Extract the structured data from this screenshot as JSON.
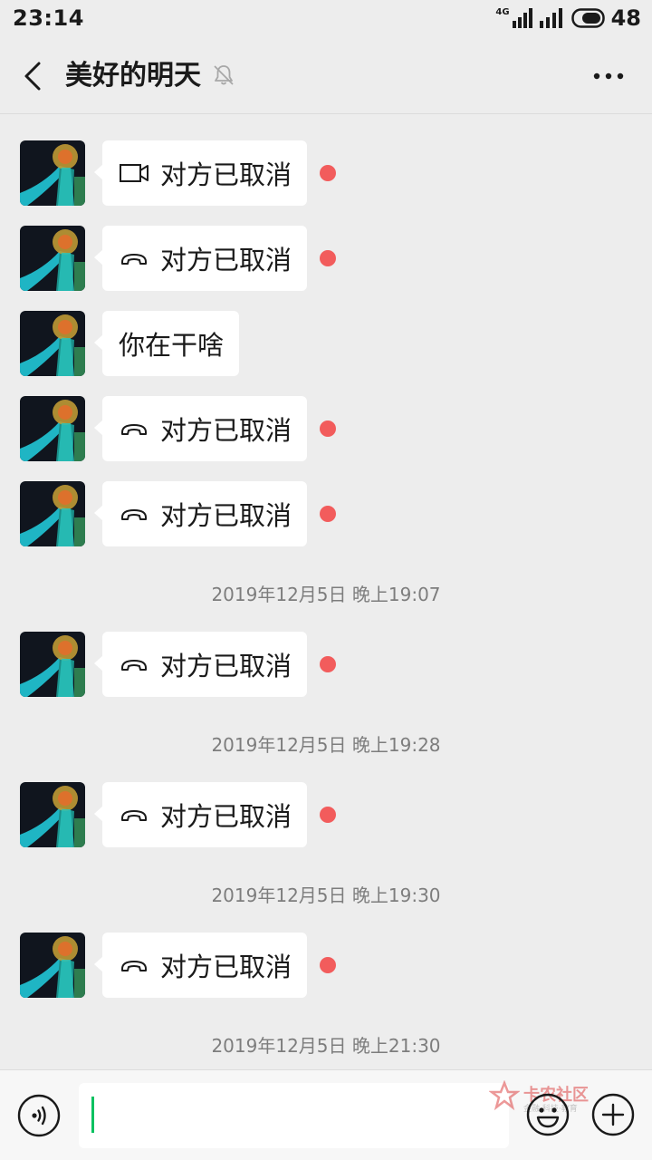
{
  "status_bar": {
    "time": "23:14",
    "network": "4G",
    "battery": "48"
  },
  "header": {
    "title": "美好的明天"
  },
  "colors": {
    "background": "#ededed",
    "bubble": "#ffffff",
    "unread_dot": "#f25c5c",
    "cursor": "#07c160"
  },
  "messages": [
    {
      "type": "call",
      "icon": "video-camera-icon",
      "text": "对方已取消",
      "unread": true
    },
    {
      "type": "call",
      "icon": "phone-hangup-icon",
      "text": "对方已取消",
      "unread": true
    },
    {
      "type": "text",
      "text": "你在干啥",
      "unread": false
    },
    {
      "type": "call",
      "icon": "phone-hangup-icon",
      "text": "对方已取消",
      "unread": true
    },
    {
      "type": "call",
      "icon": "phone-hangup-icon",
      "text": "对方已取消",
      "unread": true
    },
    {
      "type": "time",
      "text": "2019年12月5日 晚上19:07"
    },
    {
      "type": "call",
      "icon": "phone-hangup-icon",
      "text": "对方已取消",
      "unread": true
    },
    {
      "type": "time",
      "text": "2019年12月5日 晚上19:28"
    },
    {
      "type": "call",
      "icon": "phone-hangup-icon",
      "text": "对方已取消",
      "unread": true
    },
    {
      "type": "time",
      "text": "2019年12月5日 晚上19:30"
    },
    {
      "type": "call",
      "icon": "phone-hangup-icon",
      "text": "对方已取消",
      "unread": true
    },
    {
      "type": "time",
      "text": "2019年12月5日 晚上21:30"
    }
  ],
  "input_bar": {
    "placeholder": ""
  },
  "watermark": {
    "title": "卡农社区",
    "subtitle": "金融·科技·教育"
  }
}
